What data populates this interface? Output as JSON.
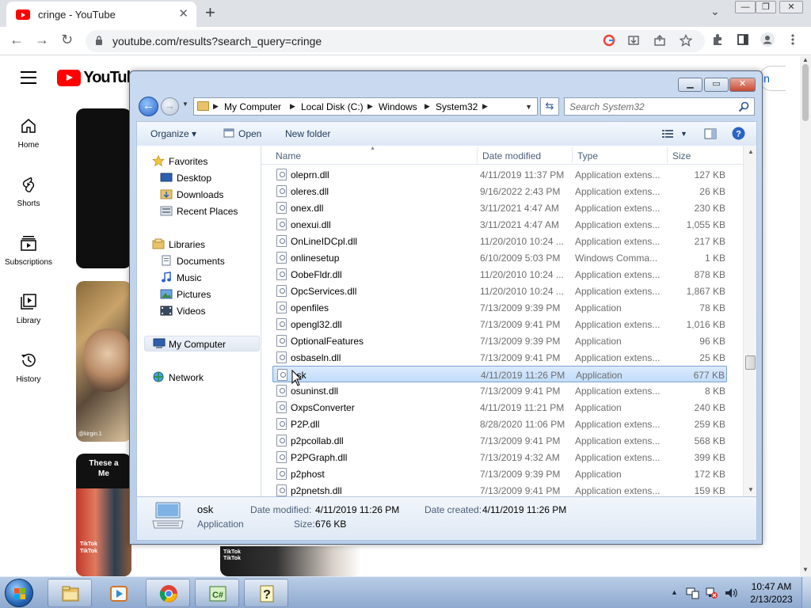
{
  "browser": {
    "tab_title": "cringe - YouTube",
    "tab_close": "✕",
    "new_tab": "+",
    "tab_menu": "⌄",
    "window_min": "—",
    "window_restore": "❐",
    "window_close": "✕",
    "back": "←",
    "forward": "→",
    "reload": "↻",
    "url": "youtube.com/results?search_query=cringe"
  },
  "youtube": {
    "logo_text": "YouTube",
    "signin_fragment": "in",
    "guide": [
      {
        "label": "Home",
        "icon": "home-icon"
      },
      {
        "label": "Shorts",
        "icon": "shorts-icon"
      },
      {
        "label": "Subscriptions",
        "icon": "subscriptions-icon"
      },
      {
        "label": "Library",
        "icon": "library-icon"
      },
      {
        "label": "History",
        "icon": "history-icon"
      }
    ],
    "thumb2_watermark": "@kirgin.1",
    "thumb3_caption": "These a\nMe",
    "thumb3_tiktok": "TikTok\nTikTok",
    "thumb4_tiktok": "TikTok\nTikTok"
  },
  "explorer": {
    "address": [
      "My Computer",
      "Local Disk (C:)",
      "Windows",
      "System32"
    ],
    "search_placeholder": "Search System32",
    "toolbar": {
      "organize": "Organize",
      "open": "Open",
      "new_folder": "New folder"
    },
    "nav": {
      "favorites": "Favorites",
      "desktop": "Desktop",
      "downloads": "Downloads",
      "recent_places": "Recent Places",
      "libraries": "Libraries",
      "documents": "Documents",
      "music": "Music",
      "pictures": "Pictures",
      "videos": "Videos",
      "my_computer": "My Computer",
      "network": "Network"
    },
    "columns": {
      "name": "Name",
      "date_modified": "Date modified",
      "type": "Type",
      "size": "Size"
    },
    "files": [
      {
        "name": "oleprn.dll",
        "date": "4/11/2019 11:37 PM",
        "type": "Application extens...",
        "size": "127 KB"
      },
      {
        "name": "oleres.dll",
        "date": "9/16/2022 2:43 PM",
        "type": "Application extens...",
        "size": "26 KB"
      },
      {
        "name": "onex.dll",
        "date": "3/11/2021 4:47 AM",
        "type": "Application extens...",
        "size": "230 KB"
      },
      {
        "name": "onexui.dll",
        "date": "3/11/2021 4:47 AM",
        "type": "Application extens...",
        "size": "1,055 KB"
      },
      {
        "name": "OnLineIDCpl.dll",
        "date": "11/20/2010 10:24 ...",
        "type": "Application extens...",
        "size": "217 KB"
      },
      {
        "name": "onlinesetup",
        "date": "6/10/2009 5:03 PM",
        "type": "Windows Comma...",
        "size": "1 KB"
      },
      {
        "name": "OobeFldr.dll",
        "date": "11/20/2010 10:24 ...",
        "type": "Application extens...",
        "size": "878 KB"
      },
      {
        "name": "OpcServices.dll",
        "date": "11/20/2010 10:24 ...",
        "type": "Application extens...",
        "size": "1,867 KB"
      },
      {
        "name": "openfiles",
        "date": "7/13/2009 9:39 PM",
        "type": "Application",
        "size": "78 KB"
      },
      {
        "name": "opengl32.dll",
        "date": "7/13/2009 9:41 PM",
        "type": "Application extens...",
        "size": "1,016 KB"
      },
      {
        "name": "OptionalFeatures",
        "date": "7/13/2009 9:39 PM",
        "type": "Application",
        "size": "96 KB"
      },
      {
        "name": "osbaseln.dll",
        "date": "7/13/2009 9:41 PM",
        "type": "Application extens...",
        "size": "25 KB"
      },
      {
        "name": "osk",
        "date": "4/11/2019 11:26 PM",
        "type": "Application",
        "size": "677 KB"
      },
      {
        "name": "osuninst.dll",
        "date": "7/13/2009 9:41 PM",
        "type": "Application extens...",
        "size": "8 KB"
      },
      {
        "name": "OxpsConverter",
        "date": "4/11/2019 11:21 PM",
        "type": "Application",
        "size": "240 KB"
      },
      {
        "name": "P2P.dll",
        "date": "8/28/2020 11:06 PM",
        "type": "Application extens...",
        "size": "259 KB"
      },
      {
        "name": "p2pcollab.dll",
        "date": "7/13/2009 9:41 PM",
        "type": "Application extens...",
        "size": "568 KB"
      },
      {
        "name": "P2PGraph.dll",
        "date": "7/13/2019 4:32 AM",
        "type": "Application extens...",
        "size": "399 KB"
      },
      {
        "name": "p2phost",
        "date": "7/13/2009 9:39 PM",
        "type": "Application",
        "size": "172 KB"
      },
      {
        "name": "p2pnetsh.dll",
        "date": "7/13/2009 9:41 PM",
        "type": "Application extens...",
        "size": "159 KB"
      }
    ],
    "details": {
      "name": "osk",
      "kind": "Application",
      "date_modified_label": "Date modified:",
      "date_modified": "4/11/2019 11:26 PM",
      "date_created_label": "Date created:",
      "date_created": "4/11/2019 11:26 PM",
      "size_label": "Size:",
      "size": "676 KB"
    }
  },
  "taskbar": {
    "time": "10:47 AM",
    "date": "2/13/2023"
  },
  "colors": {
    "youtube_red": "#ff0000",
    "explorer_chrome": "#c9daf0",
    "selection": "#c1dcfc",
    "taskbar": "#8ea9cf"
  }
}
